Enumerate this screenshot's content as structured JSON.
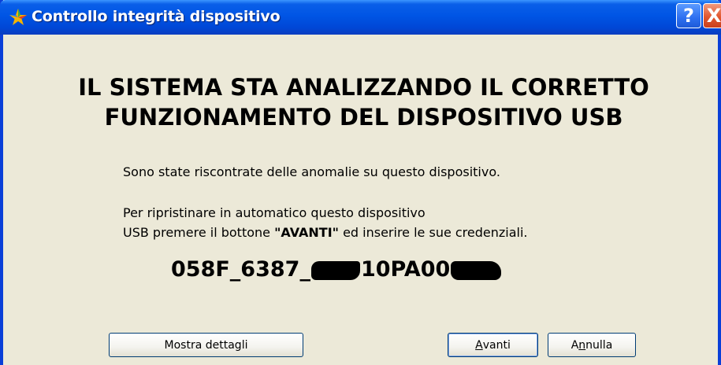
{
  "window": {
    "title": "Controllo integrità dispositivo",
    "help_label": "?",
    "close_label": "X"
  },
  "content": {
    "heading_line1": "IL SISTEMA STA ANALIZZANDO IL CORRETTO",
    "heading_line2": "FUNZIONAMENTO DEL DISPOSITIVO USB",
    "message1": "Sono state riscontrate delle anomalie su questo dispositivo.",
    "message2_line1": "Per ripristinare in automatico questo dispositivo",
    "message2_line2_pre": "USB premere il bottone ",
    "message2_line2_bold": "\"AVANTI\"",
    "message2_line2_post": " ed inserire le sue credenziali.",
    "serial_part1": "058F_6387_",
    "serial_part2": "10PA00"
  },
  "buttons": {
    "details": "Mostra dettagli",
    "next_u": "A",
    "next_rest": "vanti",
    "cancel_pre": "A",
    "cancel_u": "n",
    "cancel_rest": "nulla"
  }
}
